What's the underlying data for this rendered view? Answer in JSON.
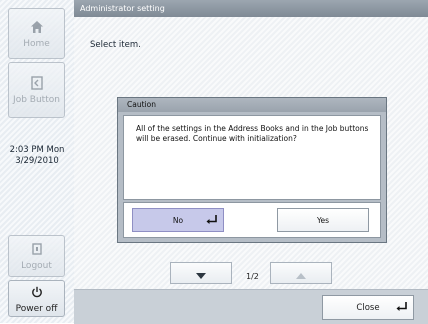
{
  "sidebar": {
    "home_label": "Home",
    "job_button_label": "Job Button",
    "time": "2:03 PM  Mon",
    "date": "3/29/2010",
    "logout_label": "Logout",
    "power_label": "Power off"
  },
  "header": {
    "title": "Administrator setting"
  },
  "main": {
    "instruction": "Select item."
  },
  "pager": {
    "indicator": "1/2"
  },
  "footer": {
    "close_label": "Close"
  },
  "dialog": {
    "title": "Caution",
    "message": "All of the settings in the Address Books and in the Job buttons will be erased.  Continue with initialization?",
    "no_label": "No",
    "yes_label": "Yes"
  }
}
